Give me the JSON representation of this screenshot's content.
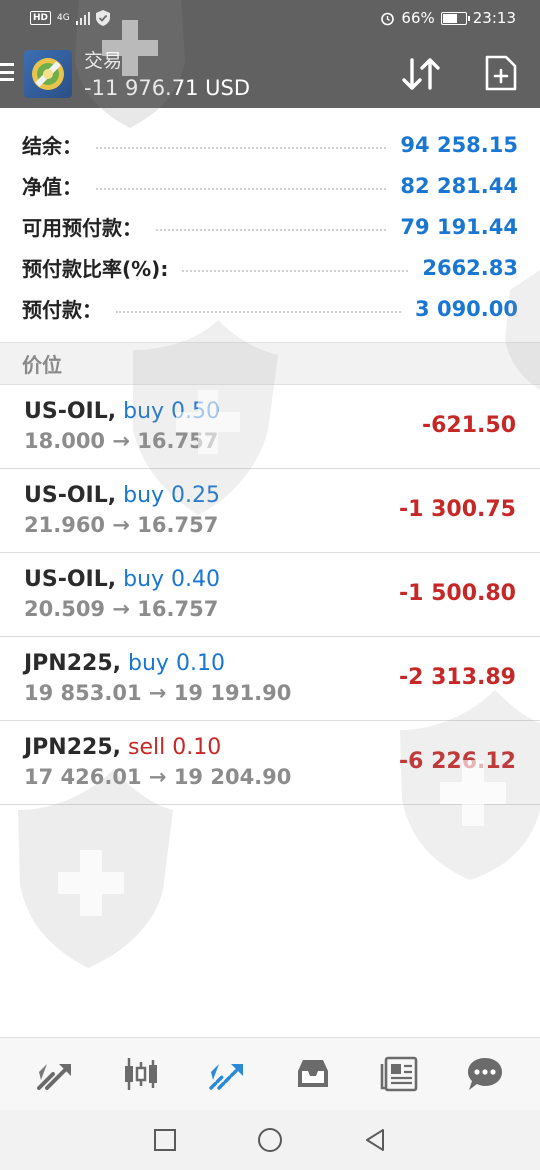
{
  "status_bar": {
    "hd": "HD",
    "network": "4G",
    "battery": "66%",
    "battery_level": 0.66,
    "time": "23:13"
  },
  "header": {
    "title": "交易",
    "subtitle": "-11 976.71 USD",
    "icons": [
      "menu-icon",
      "app-logo",
      "sort-icon",
      "new-order-icon"
    ]
  },
  "account": [
    {
      "label": "结余：",
      "value": "94 258.15"
    },
    {
      "label": "净值：",
      "value": "82 281.44"
    },
    {
      "label": "可用预付款：",
      "value": "79 191.44"
    },
    {
      "label": "预付款比率(%):",
      "value": "2662.83"
    },
    {
      "label": "预付款：",
      "value": "3 090.00"
    }
  ],
  "section_title": "价位",
  "positions": [
    {
      "symbol": "US-OIL,",
      "direction": "buy",
      "volume": "0.50",
      "open": "18.000",
      "arrow": "→",
      "current": "16.757",
      "profit": "-621.50"
    },
    {
      "symbol": "US-OIL,",
      "direction": "buy",
      "volume": "0.25",
      "open": "21.960",
      "arrow": "→",
      "current": "16.757",
      "profit": "-1 300.75"
    },
    {
      "symbol": "US-OIL,",
      "direction": "buy",
      "volume": "0.40",
      "open": "20.509",
      "arrow": "→",
      "current": "16.757",
      "profit": "-1 500.80"
    },
    {
      "symbol": "JPN225,",
      "direction": "buy",
      "volume": "0.10",
      "open": "19 853.01",
      "arrow": "→",
      "current": "19 191.90",
      "profit": "-2 313.89"
    },
    {
      "symbol": "JPN225,",
      "direction": "sell",
      "volume": "0.10",
      "open": "17 426.01",
      "arrow": "→",
      "current": "19 204.90",
      "profit": "-6 226.12"
    }
  ],
  "bottom_nav": [
    "quotes-icon",
    "chart-icon",
    "trade-icon",
    "history-icon",
    "news-icon",
    "chat-icon"
  ],
  "system_nav": [
    "recent-apps-icon",
    "home-icon",
    "back-icon"
  ],
  "colors": {
    "accent": "#1976d2",
    "loss": "#c62828",
    "header": "#616161"
  }
}
